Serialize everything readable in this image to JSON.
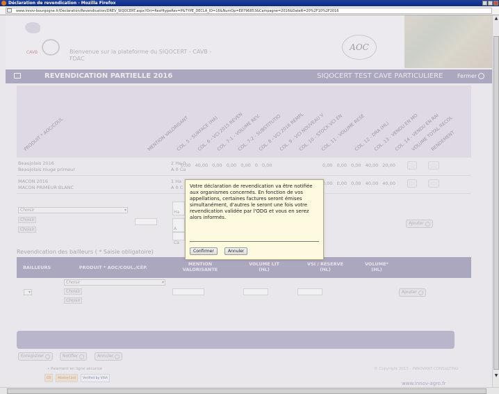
{
  "window": {
    "title": "Déclaration de revendication - Mozilla Firefox"
  },
  "browser": {
    "url": "www.innov-bourgogne.fr/Declaration/Revendication/DREV_SIQOCERT.aspx?Ori=ResHtypeRev=P&TYPE_DECLA_ID=16&NumOp=E8796853&Campagne=2016&DateR=20%2F10%2F2016"
  },
  "header": {
    "welcome_line1": "Bienvenue sur la plateforme du SIQOCERT - CAVB -",
    "welcome_line2": "FDAC",
    "cavb_logo_text": "CAVB",
    "aoc_logo_text": "AOC"
  },
  "titlebar": {
    "title": "REVENDICATION PARTIELLE 2016",
    "right_title": "SIQOCERT TEST CAVE PARTICULIERE",
    "close_label": "Fermer"
  },
  "columns": [
    "PRODUIT * AOC/COUL",
    "MENTION VALORISANT",
    "COL. 5 - SURFACE (HA)",
    "COL. 6 - VCI 2015 REVEN",
    "COL. 7-1 - VOLUME REV.",
    "COL. 7-2 - SUBSTITUTIO",
    "COL. 8 - VCI 2016 REMPL",
    "COL. 9 - VCI NOUVEAU V",
    "COL. 10 - STOCK VCI EN",
    "COL. 11 - VOLUME RESE",
    "COL. 12 - DRA (HL)",
    "COL. 13 - VENDU EN MO",
    "COL. 14 - VENDU EN RAI",
    "VOLUME TOTAL RECOL",
    "RENDEMENT"
  ],
  "rows": [
    {
      "product_line1": "Beaujolais 2016",
      "product_line2": "Beaujolais rouge primeur",
      "mention_line1": "2 Ha 0",
      "mention_line2": "A 0 Ca",
      "vals": "0,00  40,00  0,00  0,00  0,00  0  0,00",
      "vals2": "0,00  0,00  0,00  40,00  20,00"
    },
    {
      "product_line1": "MACON 2016",
      "product_line2": "MACON PRIMEUR BLANC",
      "mention_line1": "1 Ha",
      "mention_line2": "A 0 C",
      "vals": "",
      "vals2": "0,00  0,00  0,00  40,00  40,00"
    }
  ],
  "addform": {
    "select_product": "Choisir",
    "mini_select_1": "Choisir",
    "mini_select_2": "Choisir",
    "label_ha": "Ha",
    "label_a": "A",
    "label_ca": "Ca",
    "add_label": "Ajouter"
  },
  "bailleurs": {
    "title": "Revendication des bailleurs ( * Saisie obligatoire)",
    "headers": {
      "bailleurs": "BAILLEURS",
      "produit": "PRODUIT * AOC/COUL./CÉP.",
      "mention_l1": "MENTION",
      "mention_l2": "VALORISANTE",
      "volume_l1": "VOLUME LIT",
      "volume_l2": "(HL)",
      "reserve_l1": "VSI / RESERVE",
      "reserve_l2": "(HL)",
      "volume_star_l1": "VOLUME*",
      "volume_star_l2": "(HL)"
    },
    "select_product": "Choisir",
    "mini_select_1": "Choisir",
    "mini_select_2": "Choisir",
    "add_label": "Ajouter"
  },
  "bottom_buttons": {
    "save": "Enregistrer",
    "notify": "Notifier",
    "cancel": "Annuler"
  },
  "footer": {
    "secure": "• Paiement en ligne sécurisé",
    "card_1": "CB",
    "card_2": "MasterCard",
    "card_3": "Verified by VISA",
    "copyright": "© Copyright 2015 - INNOVANT CONSULTING",
    "link": "www.innov-agro.fr"
  },
  "dialog": {
    "message": "Votre déclaration de revendication va être notifiée aux organismes concernés. En fonction de vos appellations, certaines factures seront émises simultanément, d'autres le seront une fois votre revendication validée par l'ODG et vous en serez alors informés.",
    "confirm": "Confirmer",
    "cancel": "Annuler"
  }
}
